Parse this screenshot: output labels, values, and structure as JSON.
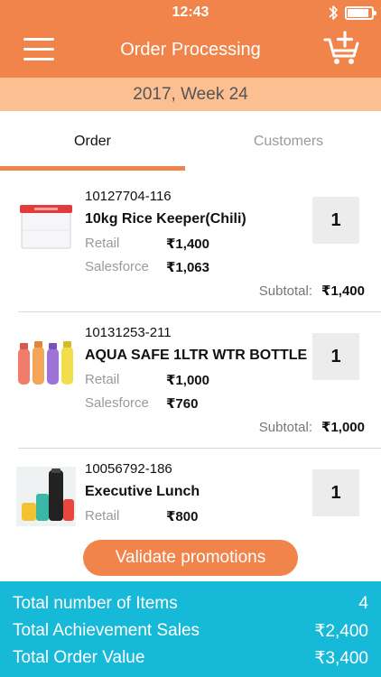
{
  "status_bar": {
    "time": "12:43"
  },
  "header": {
    "title": "Order Processing",
    "week": "2017, Week 24"
  },
  "tabs": [
    {
      "label": "Order",
      "active": true
    },
    {
      "label": "Customers",
      "active": false
    }
  ],
  "order_items": [
    {
      "sku": "10127704-116",
      "name": "10kg Rice Keeper(Chili)",
      "retail_label": "Retail",
      "retail_price": "₹1,400",
      "salesforce_label": "Salesforce",
      "salesforce_price": "₹1,063",
      "subtotal_label": "Subtotal:",
      "subtotal": "₹1,400",
      "quantity": "1"
    },
    {
      "sku": "10131253-211",
      "name": "AQUA SAFE 1LTR WTR BOTTLE",
      "retail_label": "Retail",
      "retail_price": "₹1,000",
      "salesforce_label": "Salesforce",
      "salesforce_price": "₹760",
      "subtotal_label": "Subtotal:",
      "subtotal": "₹1,000",
      "quantity": "1"
    },
    {
      "sku": "10056792-186",
      "name": "Executive Lunch",
      "retail_label": "Retail",
      "retail_price": "₹800",
      "quantity": "1"
    }
  ],
  "validate_button": "Validate promotions",
  "totals": {
    "items_label": "Total number of Items",
    "items_value": "4",
    "achievement_label": "Total Achievement Sales",
    "achievement_value": "₹2,400",
    "order_value_label": "Total Order Value",
    "order_value": "₹3,400"
  },
  "colors": {
    "accent": "#f0844a",
    "week_bar": "#fbbf92",
    "footer": "#17b9d8"
  },
  "icons": [
    "menu-icon",
    "add-to-cart-icon",
    "bluetooth-icon",
    "battery-icon"
  ]
}
